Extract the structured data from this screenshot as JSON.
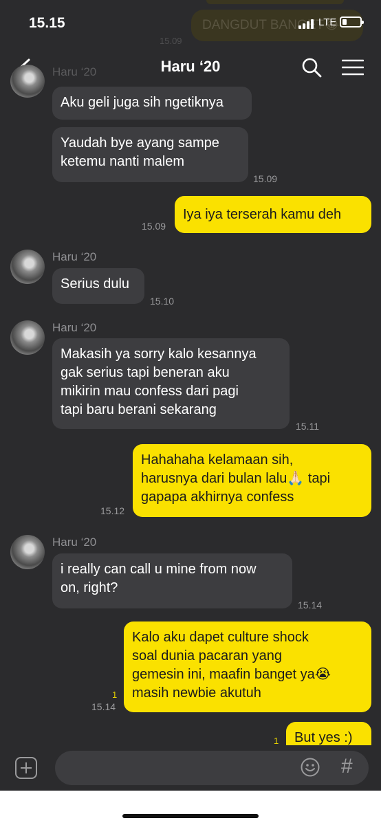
{
  "status": {
    "time": "15.15",
    "network": "LTE"
  },
  "ghost_message": {
    "text": "DANGDUT BANGET😂",
    "time": "15.09"
  },
  "header": {
    "title": "Haru ‘20"
  },
  "messages": [
    {
      "type": "in",
      "text": "Aku geli juga sih ngetiknya"
    },
    {
      "type": "in",
      "text": "Yaudah bye ayang sampe\nketemu nanti malem",
      "time": "15.09"
    },
    {
      "type": "out",
      "text": "Iya iya terserah kamu deh",
      "time": "15.09"
    },
    {
      "type": "in",
      "sender": "Haru ‘20",
      "text": "Serius dulu",
      "time": "15.10"
    },
    {
      "type": "in",
      "sender": "Haru ‘20",
      "text": "Makasih ya sorry kalo kesannya\ngak serius tapi beneran aku\nmikirin mau confess dari pagi\ntapi baru berani sekarang",
      "time": "15.11"
    },
    {
      "type": "out",
      "text": "Hahahaha kelamaan sih,\nharusnya dari bulan lalu🙏🏻 tapi\ngapapa akhirnya confess",
      "time": "15.12"
    },
    {
      "type": "in",
      "sender": "Haru ‘20",
      "text": "i really can call u mine from now\non, right?",
      "time": "15.14"
    },
    {
      "type": "out",
      "text": "Kalo aku dapet culture shock\nsoal dunia pacaran yang\ngemesin ini, maafin banget ya😭\nmasih newbie akutuh",
      "time": "15.14",
      "unread": "1"
    },
    {
      "type": "out",
      "text": "But yes :)",
      "unread": "1"
    }
  ],
  "top_sender": "Haru ‘20",
  "input": {
    "placeholder": ""
  },
  "icons": {
    "back": "back-chevron-icon",
    "search": "search-icon",
    "menu": "hamburger-menu-icon",
    "add": "plus-icon",
    "emoji": "emoji-icon",
    "hashtag": "hashtag-icon"
  },
  "colors": {
    "background": "#2b2b2d",
    "incoming_bubble": "#3d3d40",
    "outgoing_bubble": "#fae100"
  }
}
